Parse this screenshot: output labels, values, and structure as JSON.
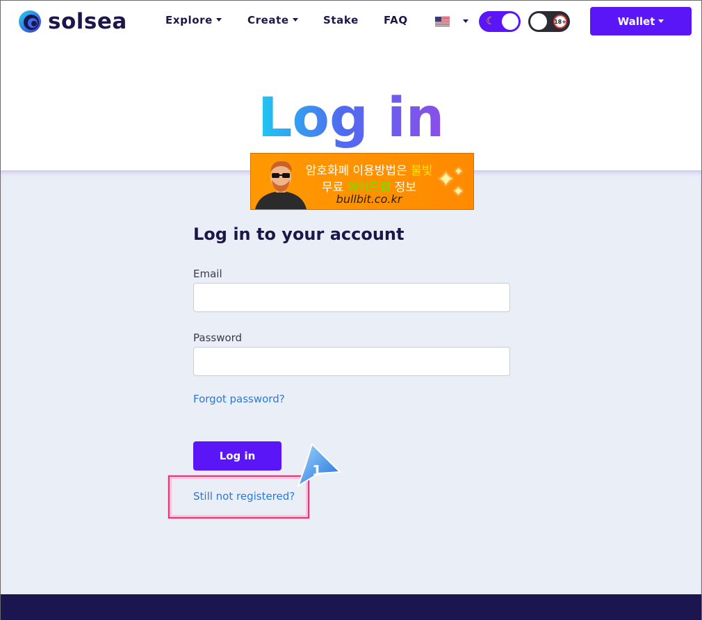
{
  "brand": {
    "name": "solsea"
  },
  "nav": {
    "items": [
      {
        "label": "Explore",
        "has_dropdown": true
      },
      {
        "label": "Create",
        "has_dropdown": true
      },
      {
        "label": "Stake",
        "has_dropdown": false
      },
      {
        "label": "FAQ",
        "has_dropdown": false
      }
    ],
    "language_flag": "us-flag-icon",
    "dark_mode_toggle": {
      "on": true,
      "icon": "moon-icon"
    },
    "adult_toggle": {
      "on": false,
      "badge": "18+"
    },
    "wallet_label": "Wallet"
  },
  "hero": {
    "title": "Log in"
  },
  "ad": {
    "line1_prefix": "암호화폐 이용방법은 ",
    "line1_highlight": "불빛",
    "line2_prefix": "무료 ",
    "line2_highlight": "에어드랍",
    "line2_suffix": " 정보",
    "url": "bullbit.co.kr"
  },
  "form": {
    "heading": "Log in to your account",
    "email_label": "Email",
    "email_value": "",
    "password_label": "Password",
    "password_value": "",
    "forgot_link": "Forgot password?",
    "submit_label": "Log in",
    "register_link": "Still not registered?"
  },
  "annotation": {
    "step_number": "1"
  },
  "colors": {
    "primary": "#5b16f7",
    "navy": "#1c1649",
    "band_bg": "#eaeef6",
    "link": "#2a78d6",
    "highlight": "#e6357a"
  }
}
